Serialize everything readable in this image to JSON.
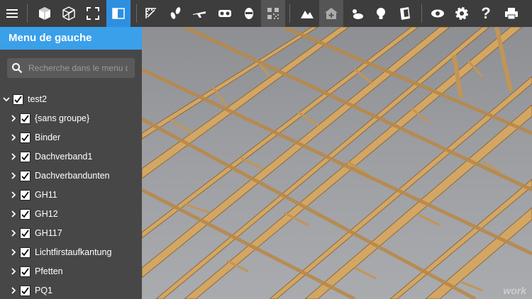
{
  "toolbar": {
    "icons": [
      "menu-icon",
      "cube-solid-icon",
      "cube-wireframe-icon",
      "fullscreen-icon",
      "panel-toggle-icon",
      "measure-icon",
      "walk-icon",
      "fly-icon",
      "vr-icon",
      "person-icon",
      "qr-code-icon",
      "terrain-icon",
      "add-view-icon",
      "weather-icon",
      "light-bulb-icon",
      "section-icon",
      "eye-icon",
      "gear-icon",
      "help-icon",
      "print-icon"
    ],
    "help_label": "?"
  },
  "panel": {
    "title": "Menu de gauche",
    "search_placeholder": "Recherche dans le menu de gauche"
  },
  "tree": {
    "root": {
      "label": "test2",
      "checked": true
    },
    "items": [
      {
        "label": "{sans groupe}",
        "checked": true
      },
      {
        "label": "Binder",
        "checked": true
      },
      {
        "label": "Dachverband1",
        "checked": true
      },
      {
        "label": "Dachverbandunten",
        "checked": true
      },
      {
        "label": "GH11",
        "checked": true
      },
      {
        "label": "GH12",
        "checked": true
      },
      {
        "label": "GH117",
        "checked": true
      },
      {
        "label": "Lichtfirstaufkantung",
        "checked": true
      },
      {
        "label": "Pfetten",
        "checked": true
      },
      {
        "label": "PQ1",
        "checked": true
      }
    ]
  },
  "viewport": {
    "watermark": "work"
  },
  "colors": {
    "accent": "#2e8fe0",
    "header": "#3aa0ea",
    "timber": "#d4a664",
    "timber_dark": "#8a6a3a"
  }
}
